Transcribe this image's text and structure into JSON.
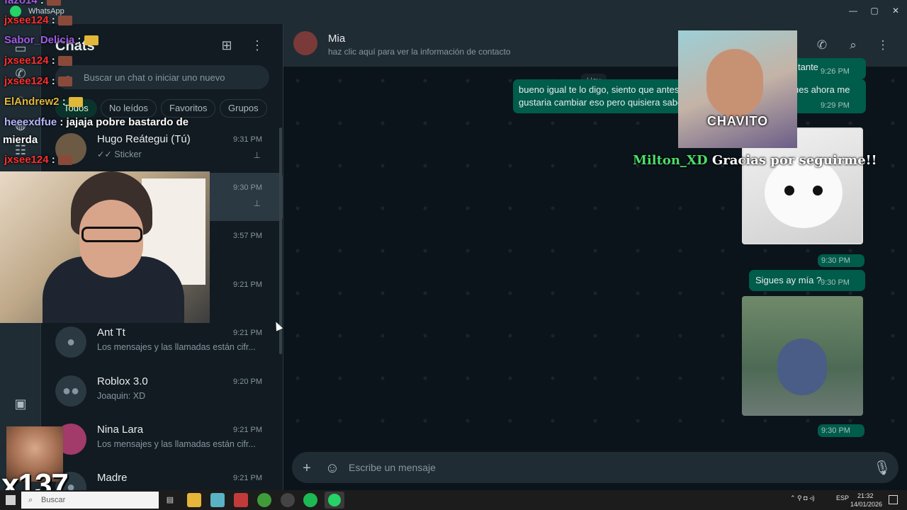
{
  "window": {
    "app_label": "WhatsApp"
  },
  "sidebar": {
    "title": "Chats",
    "search_placeholder": "Buscar un chat o iniciar uno nuevo",
    "filters": [
      "Todos",
      "No leídos",
      "Favoritos",
      "Grupos"
    ],
    "chats": [
      {
        "name": "Hugo Reátegui (Tú)",
        "time": "9:31 PM",
        "preview": "✓✓ Sticker",
        "pinned": true
      },
      {
        "name": "",
        "time": "9:30 PM",
        "preview": "",
        "pinned": true
      },
      {
        "name": "",
        "time": "3:57 PM",
        "preview": "",
        "pinned": false
      },
      {
        "name": "",
        "time": "9:21 PM",
        "preview": "s están cifr...",
        "pinned": false
      },
      {
        "name": "Ant Tt",
        "time": "9:21 PM",
        "preview": "Los mensajes y las llamadas están cifr...",
        "pinned": false
      },
      {
        "name": "Roblox 3.0",
        "time": "9:20 PM",
        "preview": "Joaquin: XD",
        "pinned": false
      },
      {
        "name": "Nina Lara",
        "time": "9:21 PM",
        "preview": "Los mensajes y las llamadas están cifr...",
        "pinned": false
      },
      {
        "name": "Madre",
        "time": "9:21 PM",
        "preview": "",
        "pinned": false
      }
    ]
  },
  "conversation": {
    "contact_name": "Mia",
    "contact_sub": "haz clic aquí para ver la información de contacto",
    "day_badge": "Hoy",
    "messages": [
      {
        "text": "tante",
        "time": "9:26 PM"
      },
      {
        "text": "bueno igual te lo digo, siento que antes",
        "text_end": "ues ahora me",
        "line2": "gustaria cambiar eso pero quisiera sabe",
        "time": "9:29 PM"
      },
      {
        "sticker": "cat",
        "time": "9:30 PM"
      },
      {
        "text": "Sigues ay mía ?",
        "time": "9:30 PM"
      },
      {
        "sticker": "stitch",
        "time": "9:30 PM"
      }
    ],
    "composer_placeholder": "Escribe un mensaje"
  },
  "overlay": {
    "chat_lines": [
      {
        "user": "fazo14",
        "msg": ":",
        "color": "#a35de6"
      },
      {
        "user": "jxsee124",
        "msg": ":",
        "color": "#ff2e2e"
      },
      {
        "user": "Sabor_Delicia",
        "msg": ":",
        "color": "#a35de6"
      },
      {
        "user": "jxsee124",
        "msg": ":",
        "color": "#ff2e2e"
      },
      {
        "user": "jxsee124",
        "msg": ":",
        "color": "#ff2e2e"
      },
      {
        "user": "ElAndrew2",
        "msg": ":",
        "color": "#e3b73a"
      },
      {
        "user": "heeexdfue",
        "msg": ": jajaja pobre bastardo de",
        "color": "#b8b5ff"
      },
      {
        "user": "mierda",
        "msg": "",
        "color": "#ffffff"
      },
      {
        "user": "jxsee124",
        "msg": ":",
        "color": "#ff2e2e"
      }
    ],
    "chavito_label": "CHAVITO",
    "follow_user": "Milton_XD",
    "follow_text": "Gracias por seguirme!!",
    "combo": "x137"
  },
  "taskbar": {
    "search_label": "Buscar",
    "lang": "ESP",
    "time": "21:32",
    "date": "14/01/2026"
  },
  "colors": {
    "accent": "#00a884",
    "bubble_out": "#005c4b",
    "bg": "#0b141a"
  }
}
